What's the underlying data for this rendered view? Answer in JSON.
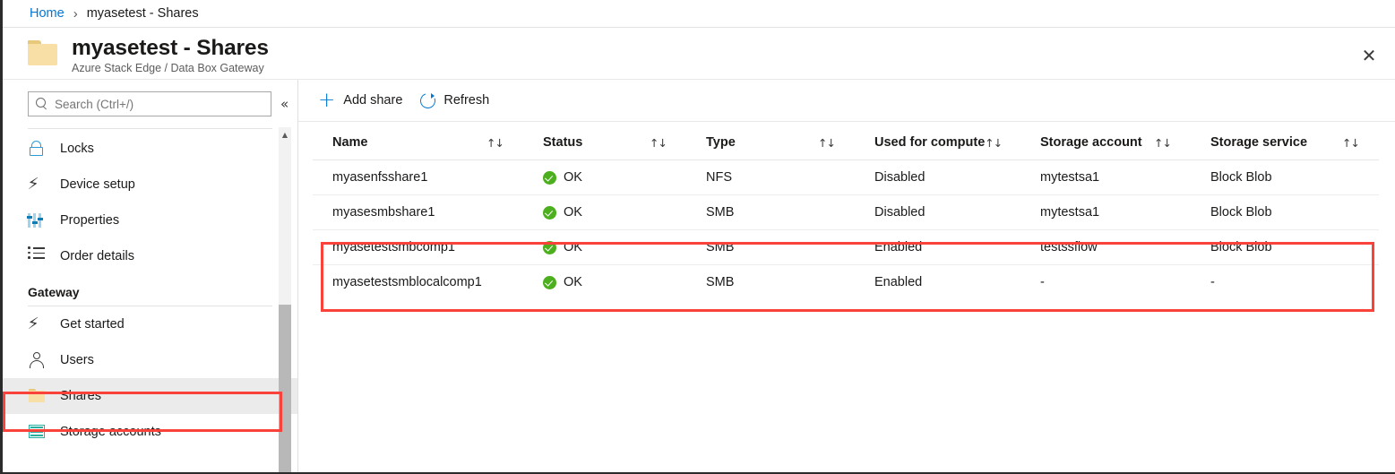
{
  "breadcrumb": {
    "home": "Home",
    "separator": "›",
    "current": "myasetest - Shares"
  },
  "blade": {
    "icon": "folder-icon",
    "title": "myasetest - Shares",
    "subtitle": "Azure Stack Edge / Data Box Gateway",
    "close_label": "✕"
  },
  "sidebar": {
    "search": {
      "placeholder": "Search (Ctrl+/)",
      "value": "",
      "icon": "search-icon"
    },
    "collapse_label": "«",
    "items": [
      {
        "label": "Locks",
        "icon": "lock-icon",
        "selected": false
      },
      {
        "label": "Device setup",
        "icon": "bolt-icon",
        "selected": false
      },
      {
        "label": "Properties",
        "icon": "sliders-icon",
        "selected": false
      },
      {
        "label": "Order details",
        "icon": "list-icon",
        "selected": false
      }
    ],
    "group": {
      "title": "Gateway",
      "items": [
        {
          "label": "Get started",
          "icon": "bolt-icon",
          "selected": false
        },
        {
          "label": "Users",
          "icon": "person-icon",
          "selected": false
        },
        {
          "label": "Shares",
          "icon": "folder-icon",
          "selected": true
        },
        {
          "label": "Storage accounts",
          "icon": "storage-icon",
          "selected": false
        }
      ]
    },
    "scroll_up_label": "▲"
  },
  "toolbar": {
    "add_share_label": "Add share",
    "add_share_icon": "plus-icon",
    "refresh_label": "Refresh",
    "refresh_icon": "refresh-icon"
  },
  "table": {
    "sort_icon": "↑↓",
    "columns": [
      "Name",
      "Status",
      "Type",
      "Used for compute",
      "Storage account",
      "Storage service"
    ],
    "rows": [
      {
        "name": "myasenfsshare1",
        "status": "OK",
        "status_icon": "check-circle-icon",
        "type": "NFS",
        "used_for_compute": "Disabled",
        "storage_account": "mytestsa1",
        "storage_service": "Block Blob"
      },
      {
        "name": "myasesmbshare1",
        "status": "OK",
        "status_icon": "check-circle-icon",
        "type": "SMB",
        "used_for_compute": "Disabled",
        "storage_account": "mytestsa1",
        "storage_service": "Block Blob"
      },
      {
        "name": "myasetestsmbcomp1",
        "status": "OK",
        "status_icon": "check-circle-icon",
        "type": "SMB",
        "used_for_compute": "Enabled",
        "storage_account": "testssflow",
        "storage_service": "Block Blob"
      },
      {
        "name": "myasetestsmblocalcomp1",
        "status": "OK",
        "status_icon": "check-circle-icon",
        "type": "SMB",
        "used_for_compute": "Enabled",
        "storage_account": "-",
        "storage_service": "-"
      }
    ]
  },
  "colors": {
    "accent": "#0078d4",
    "highlight_red": "#f9423a",
    "status_ok_green": "#4caf1d",
    "folder_yellow": "#f7dfa5",
    "storage_teal": "#2aaea0"
  }
}
